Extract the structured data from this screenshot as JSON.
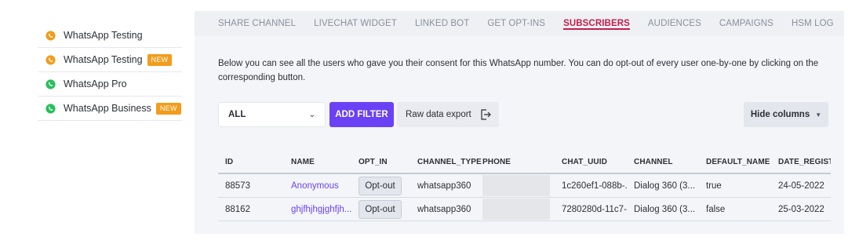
{
  "sidebar": {
    "items": [
      {
        "label": "WhatsApp Testing",
        "icon": "whatsapp-orange-icon",
        "color": "#f39c1b",
        "badge": ""
      },
      {
        "label": "WhatsApp Testing",
        "icon": "whatsapp-orange-icon",
        "color": "#f39c1b",
        "badge": "NEW"
      },
      {
        "label": "WhatsApp Pro",
        "icon": "whatsapp-green-icon",
        "color": "#25c15b",
        "badge": ""
      },
      {
        "label": "WhatsApp Business",
        "icon": "whatsapp-green-icon",
        "color": "#25c15b",
        "badge": "NEW"
      }
    ]
  },
  "tabs": [
    {
      "label": "SHARE CHANNEL",
      "active": false
    },
    {
      "label": "LIVECHAT WIDGET",
      "active": false
    },
    {
      "label": "LINKED BOT",
      "active": false
    },
    {
      "label": "GET OPT-INS",
      "active": false
    },
    {
      "label": "SUBSCRIBERS",
      "active": true
    },
    {
      "label": "AUDIENCES",
      "active": false
    },
    {
      "label": "CAMPAIGNS",
      "active": false
    },
    {
      "label": "HSM LOG",
      "active": false
    }
  ],
  "description": "Below you can see all the users who gave you their consent for this WhatsApp number. You can do opt-out of every user one-by-one by clicking on the corresponding button.",
  "toolbar": {
    "filter_select_value": "ALL",
    "add_filter_label": "ADD FILTER",
    "export_label": "Raw data export",
    "hide_columns_label": "Hide columns"
  },
  "table": {
    "headers": [
      "ID",
      "NAME",
      "OPT_IN",
      "CHANNEL_TYPE",
      "PHONE",
      "CHAT_UUID",
      "CHANNEL",
      "DEFAULT_NAME",
      "DATE_REGIST"
    ],
    "rows": [
      {
        "id": "88573",
        "name": "Anonymous",
        "opt_in": "Opt-out",
        "channel_type": "whatsapp360",
        "phone": "",
        "chat_uuid": "1c260ef1-088b-...",
        "channel": "Dialog 360 (3...",
        "default_name": "true",
        "date": "24-05-2022"
      },
      {
        "id": "88162",
        "name": "ghjfhjhgjghfjh...",
        "opt_in": "Opt-out",
        "channel_type": "whatsapp360",
        "phone": "",
        "chat_uuid": "7280280d-11c7-...",
        "channel": "Dialog 360 (3...",
        "default_name": "false",
        "date": "25-03-2022"
      }
    ]
  },
  "colors": {
    "accent": "#6b41f5",
    "active_tab": "#c41e4a",
    "badge_new": "#f39c1b"
  }
}
